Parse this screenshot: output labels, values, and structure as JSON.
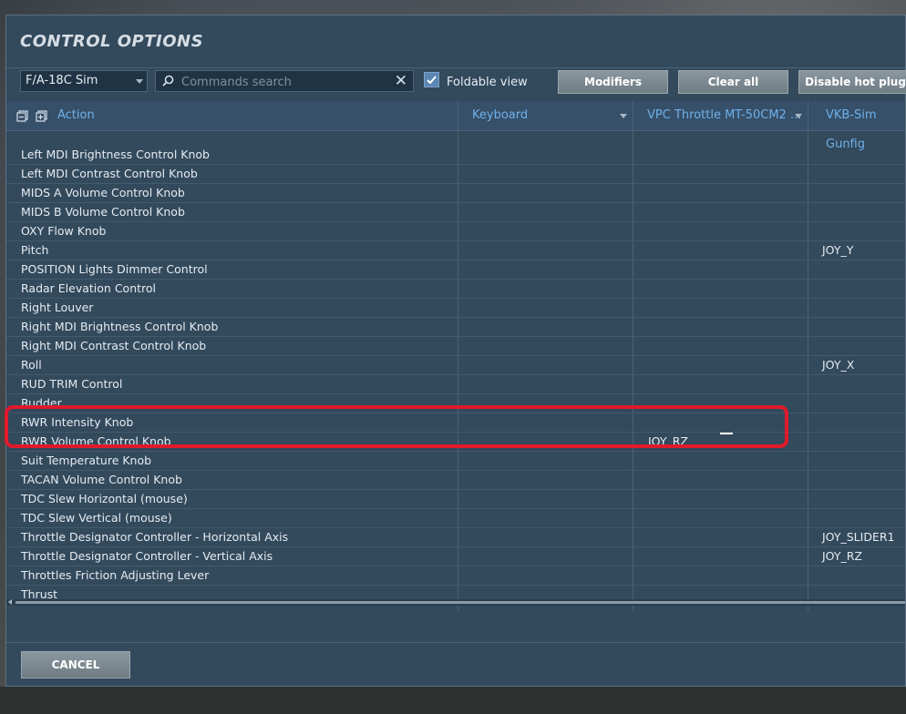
{
  "dialog": {
    "title": "CONTROL OPTIONS"
  },
  "toolbar": {
    "aircraft_select": "F/A-18C Sim",
    "search_placeholder": "Commands search",
    "clear_search": "✕",
    "foldable_view_label": "Foldable view",
    "foldable_view_checked": true,
    "modifiers_label": "Modifiers",
    "clear_all_label": "Clear all",
    "disable_hot_plug_label": "Disable hot plug"
  },
  "grid": {
    "columns": [
      "Action",
      "Keyboard",
      "VPC Throttle MT-50CM2 ...",
      "VKB-Sim Gunfig"
    ],
    "rows": [
      {
        "action": "Left MDI Brightness Control Knob",
        "keyboard": "",
        "vpc": "",
        "vkb": ""
      },
      {
        "action": "Left MDI Contrast Control Knob",
        "keyboard": "",
        "vpc": "",
        "vkb": ""
      },
      {
        "action": "MIDS A Volume Control Knob",
        "keyboard": "",
        "vpc": "",
        "vkb": ""
      },
      {
        "action": "MIDS B Volume Control Knob",
        "keyboard": "",
        "vpc": "",
        "vkb": ""
      },
      {
        "action": "OXY Flow Knob",
        "keyboard": "",
        "vpc": "",
        "vkb": ""
      },
      {
        "action": "Pitch",
        "keyboard": "",
        "vpc": "",
        "vkb": "JOY_Y"
      },
      {
        "action": "POSITION Lights Dimmer Control",
        "keyboard": "",
        "vpc": "",
        "vkb": ""
      },
      {
        "action": "Radar Elevation Control",
        "keyboard": "",
        "vpc": "",
        "vkb": ""
      },
      {
        "action": "Right Louver",
        "keyboard": "",
        "vpc": "",
        "vkb": ""
      },
      {
        "action": "Right MDI Brightness Control Knob",
        "keyboard": "",
        "vpc": "",
        "vkb": ""
      },
      {
        "action": "Right MDI Contrast Control Knob",
        "keyboard": "",
        "vpc": "",
        "vkb": ""
      },
      {
        "action": "Roll",
        "keyboard": "",
        "vpc": "",
        "vkb": "JOY_X"
      },
      {
        "action": "RUD TRIM Control",
        "keyboard": "",
        "vpc": "",
        "vkb": ""
      },
      {
        "action": "Rudder",
        "keyboard": "",
        "vpc": "",
        "vkb": ""
      },
      {
        "action": "RWR Intensity Knob",
        "keyboard": "",
        "vpc": "",
        "vkb": ""
      },
      {
        "action": "RWR Volume Control Knob",
        "keyboard": "",
        "vpc": "JOY_RZ",
        "vkb": ""
      },
      {
        "action": "Suit Temperature Knob",
        "keyboard": "",
        "vpc": "",
        "vkb": ""
      },
      {
        "action": "TACAN Volume Control Knob",
        "keyboard": "",
        "vpc": "",
        "vkb": ""
      },
      {
        "action": "TDC Slew Horizontal (mouse)",
        "keyboard": "",
        "vpc": "",
        "vkb": ""
      },
      {
        "action": "TDC Slew Vertical (mouse)",
        "keyboard": "",
        "vpc": "",
        "vkb": ""
      },
      {
        "action": "Throttle Designator Controller - Horizontal Axis",
        "keyboard": "",
        "vpc": "",
        "vkb": "JOY_SLIDER1"
      },
      {
        "action": "Throttle Designator Controller - Vertical Axis",
        "keyboard": "",
        "vpc": "",
        "vkb": "JOY_RZ"
      },
      {
        "action": "Throttles Friction Adjusting Lever",
        "keyboard": "",
        "vpc": "",
        "vkb": ""
      },
      {
        "action": "Thrust",
        "keyboard": "",
        "vpc": "",
        "vkb": ""
      }
    ]
  },
  "footer": {
    "cancel_label": "CANCEL"
  },
  "colors": {
    "dialog_bg": "#33495c",
    "header_text": "#6fb0e8",
    "highlight": "#e01a2a",
    "checkbox": "#5a86b3"
  }
}
